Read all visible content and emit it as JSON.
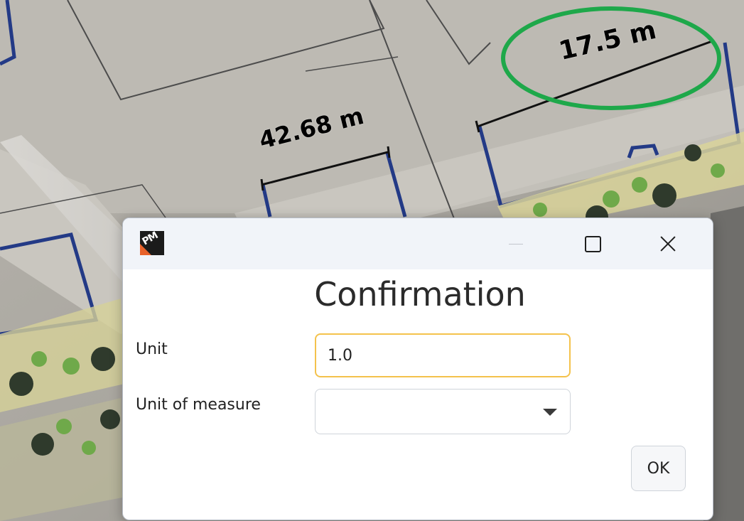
{
  "map": {
    "measurement_1": "42.68 m",
    "measurement_2": "17.5 m",
    "highlight_color": "#1ea84a",
    "parcel_line_color": "#233a86"
  },
  "dialog": {
    "app_icon": "pm-logo-icon",
    "window_controls": {
      "minimize_icon": "minimize-icon",
      "maximize_icon": "maximize-icon",
      "close_icon": "close-icon"
    },
    "title": "Confirmation",
    "fields": {
      "unit_label": "Unit",
      "unit_value": "1.0",
      "uom_label": "Unit of measure",
      "uom_value": ""
    },
    "ok_label": "OK",
    "accent_color": "#f4c24c"
  }
}
